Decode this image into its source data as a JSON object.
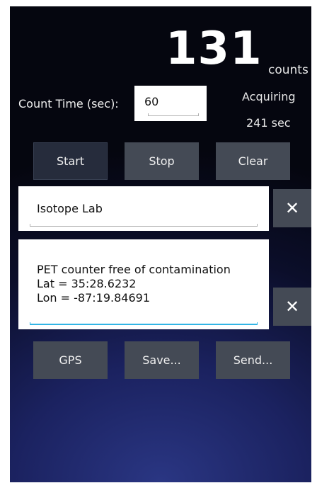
{
  "counter": {
    "value": "131",
    "unit": "counts"
  },
  "count_time": {
    "label": "Count Time (sec):",
    "value": "60"
  },
  "status": {
    "state": "Acquiring",
    "elapsed": "241 sec"
  },
  "controls": {
    "start_label": "Start",
    "stop_label": "Stop",
    "clear_label": "Clear"
  },
  "location": {
    "value": "Isotope Lab"
  },
  "notes": {
    "lines": [
      "PET counter free of contamination",
      "Lat = 35:28.6232",
      "Lon = -87:19.84691"
    ]
  },
  "actions": {
    "gps_label": "GPS",
    "save_label": "Save...",
    "send_label": "Send..."
  },
  "icons": {
    "clear_field": "close-icon"
  },
  "colors": {
    "focus_accent": "#33b5e5",
    "button_bg": "#444a55"
  }
}
